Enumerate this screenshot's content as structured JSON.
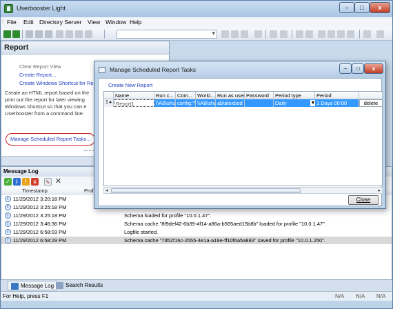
{
  "window": {
    "title": "Userbooster Light",
    "min_glyph": "–",
    "max_glyph": "□",
    "close_glyph": "x"
  },
  "menu": [
    {
      "label": "File"
    },
    {
      "label": "Edit"
    },
    {
      "label": "Directory Server"
    },
    {
      "label": "View"
    },
    {
      "label": "Window"
    },
    {
      "label": "Help"
    }
  ],
  "report_panel": {
    "title": "Report",
    "links": {
      "clear": "Clear Report View",
      "create": "Create Report...",
      "shortcut": "Create Windows Shortcut for Report...",
      "manage": "Manage Scheduled Report Tasks..."
    },
    "description": [
      "Create an HTML report based on the",
      "print out the report for later viewing",
      "Windows shortcut so that you can e",
      "Userbooster from a command line."
    ]
  },
  "dialog": {
    "title": "Manage Scheduled Report Tasks",
    "create_link": "Create New Report",
    "columns": [
      "Name",
      "Run c...",
      "Com...",
      "Worki...",
      "Run as user",
      "Password",
      "Period type",
      "Period"
    ],
    "row": {
      "number": "1",
      "name": "Report1",
      "run_command": "\\\\AB\\shu",
      "command": "config:\"\\",
      "working_dir": "\\\\AB\\shu",
      "run_as_user": "ab\\alexbod",
      "password": "",
      "period_type": "Daily",
      "period": "1 Days 00:00",
      "delete_label": "delete"
    },
    "close_label": "Close",
    "min_glyph": "–",
    "max_glyph": "□",
    "close_glyph": "x"
  },
  "message_log": {
    "title": "Message Log",
    "columns": [
      "Timestamp",
      "Profi"
    ],
    "entries": [
      {
        "timestamp": "11/29/2012 3:20:18 PM",
        "message": ""
      },
      {
        "timestamp": "11/29/2012 3:25:18 PM",
        "message": ""
      },
      {
        "timestamp": "11/29/2012 3:25:18 PM",
        "message": "Schema loaded for profile \"10.0.1.47\"."
      },
      {
        "timestamp": "11/29/2012 3:46:36 PM",
        "message": "Schema cache \"8f9def42-6b39-4f14-a86a-b565aed15b8b\" loaded for profile \"10.0.1.47\"."
      },
      {
        "timestamp": "11/29/2012 6:58:03 PM",
        "message": "Logfile started."
      },
      {
        "timestamp": "11/29/2012 6:58:29 PM",
        "message": "Schema cache \"7d52f16c-2555-4e1a-a19e-ff10f6a5a883\" saved for profile \"10.0.1.250\"."
      }
    ]
  },
  "bottom_tabs": [
    "Message Log",
    "Search Results"
  ],
  "status": {
    "help": "For Help, press F1",
    "cells": [
      "N/A",
      "N/A",
      "N/A"
    ]
  }
}
